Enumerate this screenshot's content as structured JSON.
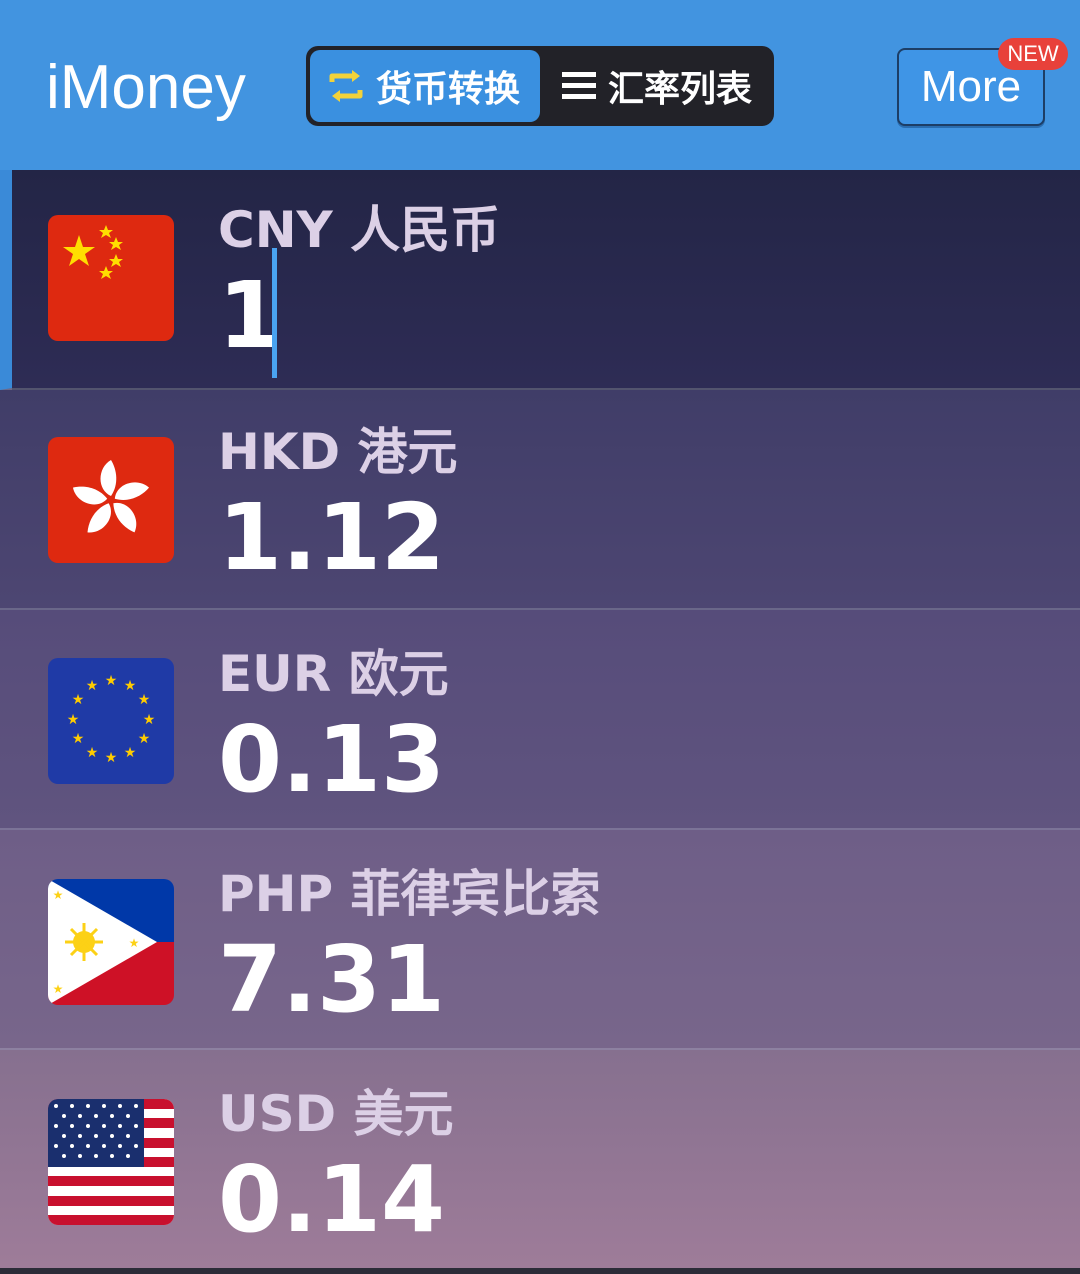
{
  "header": {
    "app_title": "iMoney",
    "tabs": [
      {
        "label": "货币转换",
        "icon": "swap-arrows-icon",
        "active": true
      },
      {
        "label": "汇率列表",
        "icon": "list-icon",
        "active": false
      }
    ],
    "more_button": "More",
    "new_badge": "NEW"
  },
  "currencies": [
    {
      "code_label": "CNY 人民币",
      "amount": "1",
      "flag": "china-flag-icon",
      "selected": true
    },
    {
      "code_label": "HKD 港元",
      "amount": "1.12",
      "flag": "hong-kong-flag-icon",
      "selected": false
    },
    {
      "code_label": "EUR 欧元",
      "amount": "0.13",
      "flag": "eu-flag-icon",
      "selected": false
    },
    {
      "code_label": "PHP 菲律宾比索",
      "amount": "7.31",
      "flag": "philippines-flag-icon",
      "selected": false
    },
    {
      "code_label": "USD 美元",
      "amount": "0.14",
      "flag": "usa-flag-icon",
      "selected": false
    }
  ],
  "colors": {
    "header_bg": "#4294e0",
    "accent": "#3a90e0",
    "badge": "#e8413a",
    "row_gradient_top": "#22254a",
    "row_gradient_bottom": "#9c7a98"
  }
}
